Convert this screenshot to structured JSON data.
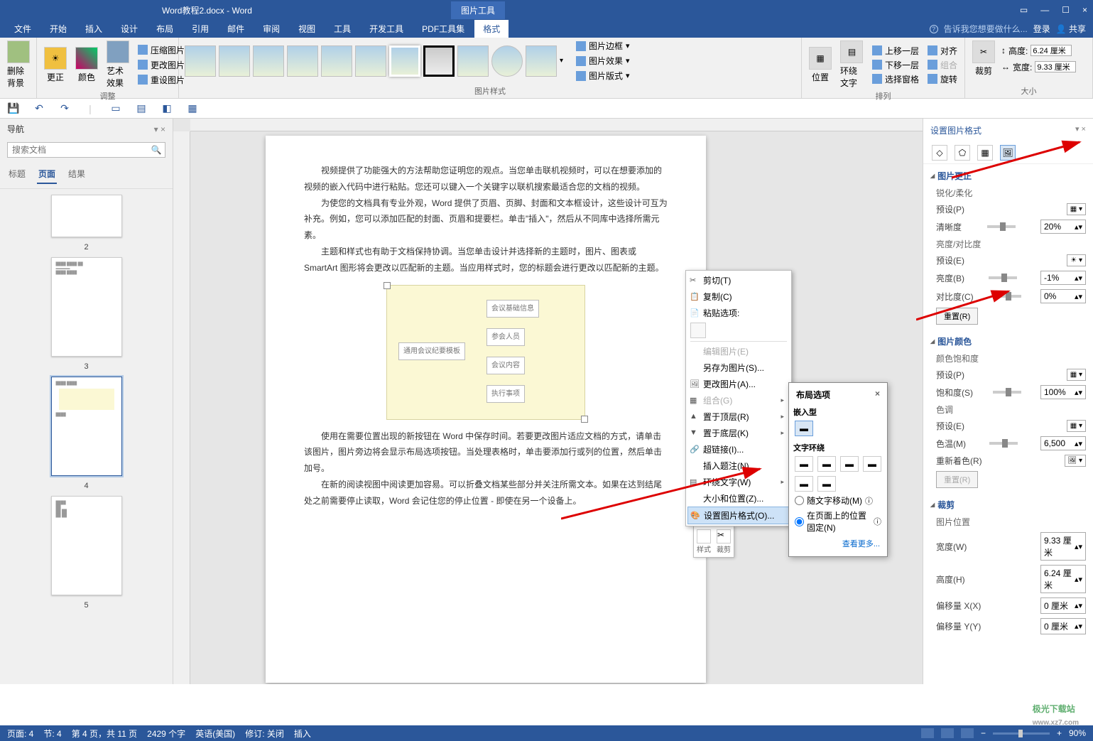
{
  "title": {
    "doc": "Word教程2.docx - Word",
    "tool": "图片工具"
  },
  "wctrls": {
    "min": "—",
    "max": "☐",
    "close": "×",
    "rib": "▭"
  },
  "menu": {
    "items": [
      "文件",
      "开始",
      "插入",
      "设计",
      "布局",
      "引用",
      "邮件",
      "审阅",
      "视图",
      "工具",
      "开发工具",
      "PDF工具集",
      "格式"
    ],
    "tell": "告诉我您想要做什么...",
    "login": "登录",
    "share": "共享"
  },
  "ribbon": {
    "g1": {
      "remove": "删除背景"
    },
    "g2": {
      "lbl": "调整",
      "correct": "更正",
      "color": "颜色",
      "artistic": "艺术效果",
      "compress": "压缩图片",
      "change": "更改图片",
      "reset": "重设图片"
    },
    "g3": {
      "lbl": "图片样式",
      "border": "图片边框",
      "effects": "图片效果",
      "layout": "图片版式"
    },
    "g4": {
      "lbl": "排列",
      "pos": "位置",
      "wrap": "环绕文字",
      "fwd": "上移一层",
      "back": "下移一层",
      "selpane": "选择窗格",
      "align": "对齐",
      "group": "组合",
      "rotate": "旋转"
    },
    "g5": {
      "lbl": "大小",
      "crop": "裁剪",
      "h": "高度:",
      "hv": "6.24 厘米",
      "w": "宽度:",
      "wv": "9.33 厘米"
    }
  },
  "nav": {
    "title": "导航",
    "search": "搜索文档",
    "tabs": [
      "标题",
      "页面",
      "结果"
    ],
    "nums": [
      "2",
      "3",
      "4",
      "5"
    ]
  },
  "doc": {
    "p1": "视频提供了功能强大的方法帮助您证明您的观点。当您单击联机视频时，可以在想要添加的视频的嵌入代码中进行粘贴。您还可以键入一个关键字以联机搜索最适合您的文档的视频。",
    "p2": "为使您的文档具有专业外观，Word 提供了页眉、页脚、封面和文本框设计，这些设计可互为补充。例如，您可以添加匹配的封面、页眉和提要栏。单击\"插入\"，然后从不同库中选择所需元素。",
    "p3": "主题和样式也有助于文档保持协调。当您单击设计并选择新的主题时，图片、图表或 SmartArt 图形将会更改以匹配新的主题。当应用样式时，您的标题会进行更改以匹配新的主题。",
    "p4": "使用在需要位置出现的新按钮在 Word 中保存时间。若要更改图片适应文档的方式，请单击该图片，图片旁边将会显示布局选项按钮。当处理表格时，单击要添加行或列的位置，然后单击加号。",
    "p5": "在新的阅读视图中阅读更加容易。可以折叠文档某些部分并关注所需文本。如果在达到结尾处之前需要停止读取，Word 会记住您的停止位置 - 即使在另一个设备上。",
    "dg": {
      "root": "通用会议纪要模板",
      "n1": "会议基础信息",
      "n2": "参会人员",
      "n3": "会议内容",
      "n4": "执行事项"
    }
  },
  "ctx": {
    "cut": "剪切(T)",
    "copy": "复制(C)",
    "pastelbl": "粘贴选项:",
    "edit": "编辑图片(E)",
    "saveas": "另存为图片(S)...",
    "change": "更改图片(A)...",
    "group": "组合(G)",
    "front": "置于顶层(R)",
    "back": "置于底层(K)",
    "link": "超链接(I)...",
    "caption": "插入题注(N)...",
    "wrap": "环绕文字(W)",
    "size": "大小和位置(Z)...",
    "fmt": "设置图片格式(O)..."
  },
  "mini": {
    "style": "样式",
    "crop": "裁剪"
  },
  "layout": {
    "title": "布局选项",
    "inline": "嵌入型",
    "wrap": "文字环绕",
    "r1": "随文字移动(M)",
    "r2": "在页面上的位置固定(N)",
    "more": "查看更多..."
  },
  "fmt": {
    "title": "设置图片格式",
    "s1": {
      "h": "图片更正",
      "sharp": "锐化/柔化",
      "preset": "预设(P)",
      "clarity": "清晰度",
      "clarityv": "20%",
      "bc": "亮度/对比度",
      "preset2": "预设(E)",
      "bright": "亮度(B)",
      "brightv": "-1%",
      "contrast": "对比度(C)",
      "contrastv": "0%",
      "reset": "重置(R)"
    },
    "s2": {
      "h": "图片颜色",
      "sat": "颜色饱和度",
      "preset": "预设(P)",
      "satlvl": "饱和度(S)",
      "satv": "100%",
      "tone": "色调",
      "preset2": "预设(E)",
      "temp": "色温(M)",
      "tempv": "6,500",
      "recolor": "重新着色(R)",
      "reset": "重置(R)"
    },
    "s3": {
      "h": "裁剪",
      "pos": "图片位置",
      "w": "宽度(W)",
      "wv": "9.33 厘米",
      "h2": "高度(H)",
      "hv": "6.24 厘米",
      "ox": "偏移量 X(X)",
      "oxv": "0 厘米",
      "oy": "偏移量 Y(Y)",
      "oyv": "0 厘米"
    }
  },
  "status": {
    "page": "页面: 4",
    "sec": "节: 4",
    "pages": "第 4 页，共 11 页",
    "words": "2429 个字",
    "lang": "英语(美国)",
    "rev": "修订: 关闭",
    "ins": "插入",
    "zoom": "90%"
  },
  "watermark": {
    "main": "极光下载站",
    "sub": "www.xz7.com"
  }
}
